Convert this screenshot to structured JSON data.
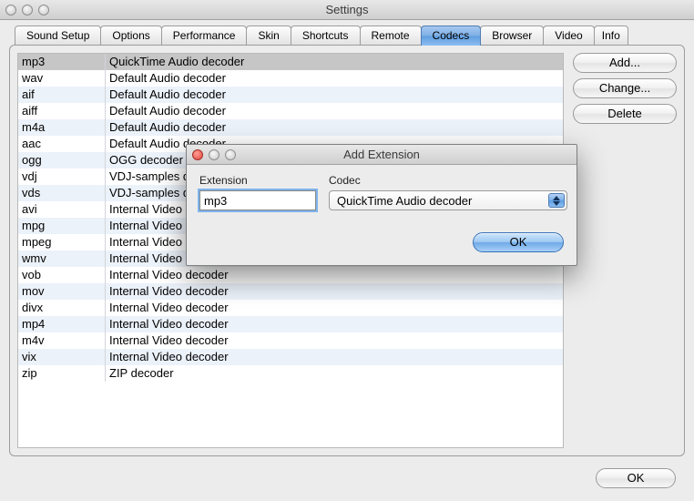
{
  "window": {
    "title": "Settings"
  },
  "tabs": [
    {
      "label": "Sound Setup"
    },
    {
      "label": "Options"
    },
    {
      "label": "Performance"
    },
    {
      "label": "Skin"
    },
    {
      "label": "Shortcuts"
    },
    {
      "label": "Remote"
    },
    {
      "label": "Codecs",
      "selected": true
    },
    {
      "label": "Browser"
    },
    {
      "label": "Video"
    },
    {
      "label": "Info"
    }
  ],
  "codecs": [
    {
      "ext": "mp3",
      "decoder": "QuickTime Audio decoder",
      "selected": true
    },
    {
      "ext": "wav",
      "decoder": "Default Audio decoder"
    },
    {
      "ext": "aif",
      "decoder": "Default Audio decoder"
    },
    {
      "ext": "aiff",
      "decoder": "Default Audio decoder"
    },
    {
      "ext": "m4a",
      "decoder": "Default Audio decoder"
    },
    {
      "ext": "aac",
      "decoder": "Default Audio decoder"
    },
    {
      "ext": "ogg",
      "decoder": "OGG decoder"
    },
    {
      "ext": "vdj",
      "decoder": "VDJ-samples decoder"
    },
    {
      "ext": "vds",
      "decoder": "VDJ-samples decoder"
    },
    {
      "ext": "avi",
      "decoder": "Internal Video decoder"
    },
    {
      "ext": "mpg",
      "decoder": "Internal Video decoder"
    },
    {
      "ext": "mpeg",
      "decoder": "Internal Video decoder"
    },
    {
      "ext": "wmv",
      "decoder": "Internal Video decoder"
    },
    {
      "ext": "vob",
      "decoder": "Internal Video decoder"
    },
    {
      "ext": "mov",
      "decoder": "Internal Video decoder"
    },
    {
      "ext": "divx",
      "decoder": "Internal Video decoder"
    },
    {
      "ext": "mp4",
      "decoder": "Internal Video decoder"
    },
    {
      "ext": "m4v",
      "decoder": "Internal Video decoder"
    },
    {
      "ext": "vix",
      "decoder": "Internal Video decoder"
    },
    {
      "ext": "zip",
      "decoder": "ZIP decoder"
    }
  ],
  "side": {
    "add": "Add...",
    "change": "Change...",
    "delete": "Delete"
  },
  "footer": {
    "ok": "OK"
  },
  "modal": {
    "title": "Add Extension",
    "ext_label": "Extension",
    "codec_label": "Codec",
    "ext_value": "mp3",
    "codec_value": "QuickTime Audio decoder",
    "ok": "OK"
  }
}
